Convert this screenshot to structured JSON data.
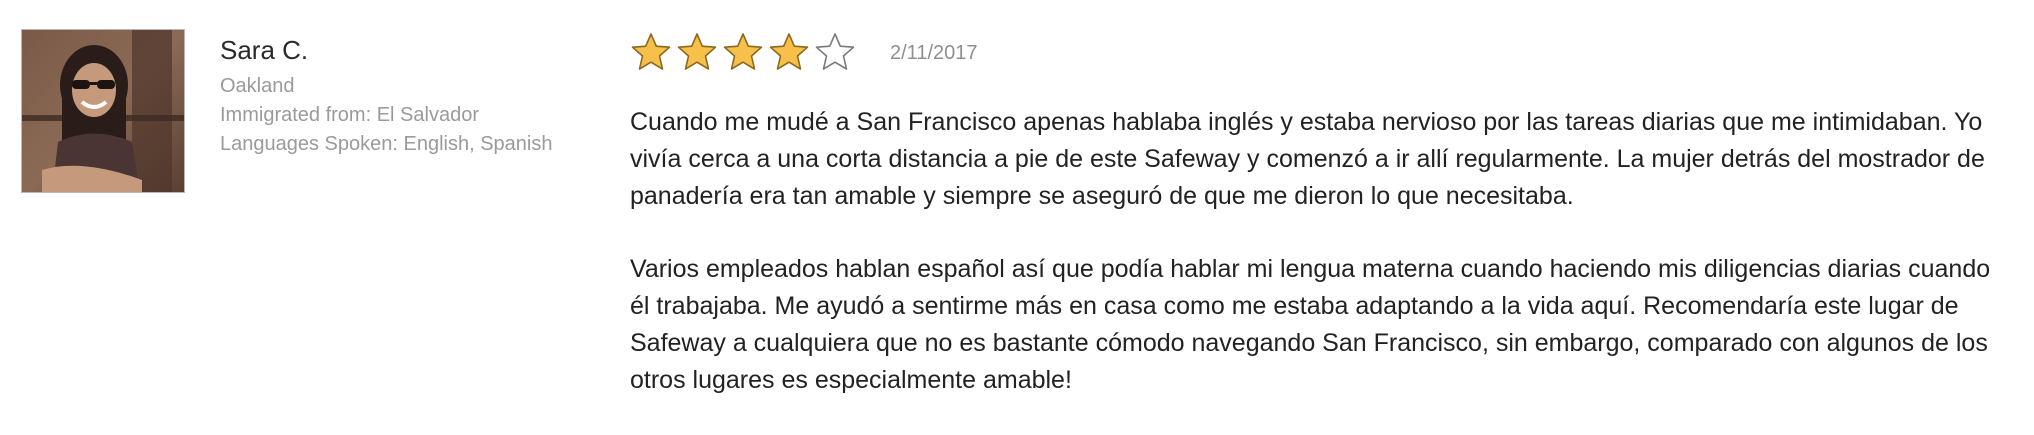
{
  "reviewer": {
    "name": "Sara C.",
    "location": "Oakland",
    "immigrated_from": "Immigrated from: El Salvador",
    "languages": "Languages Spoken: English, Spanish"
  },
  "review": {
    "rating": 4,
    "max_rating": 5,
    "date": "2/11/2017",
    "paragraphs": [
      "Cuando me mudé a San Francisco apenas hablaba inglés y estaba nervioso por las tareas diarias que me intimidaban. Yo vivía cerca a una corta distancia a pie de este Safeway y comenzó a ir allí regularmente. La mujer detrás del mostrador de panadería era tan amable y siempre se aseguró de que me dieron lo que necesitaba.",
      "Varios empleados hablan español así que podía hablar mi lengua materna cuando haciendo mis diligencias diarias cuando él trabajaba. Me ayudó a sentirme más en casa como me estaba adaptando a la vida aquí. Recomendaría este lugar de Safeway a cualquiera que no es bastante cómodo navegando San Francisco, sin embargo, comparado con algunos de los otros lugares es especialmente amable!"
    ]
  },
  "colors": {
    "star_fill": "#f7c04a",
    "star_stroke": "#8a6a1e",
    "star_empty_stroke": "#7a7a7a",
    "meta_text": "#9a9a9a"
  },
  "icons": {
    "avatar": "reviewer-photo",
    "star_full": "star-filled-icon",
    "star_empty": "star-empty-icon"
  }
}
